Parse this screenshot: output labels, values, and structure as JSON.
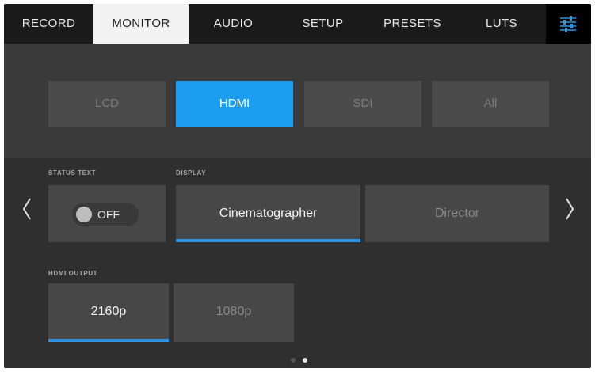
{
  "tabs": [
    {
      "label": "RECORD"
    },
    {
      "label": "MONITOR",
      "active": true
    },
    {
      "label": "AUDIO"
    },
    {
      "label": "SETUP"
    },
    {
      "label": "PRESETS"
    },
    {
      "label": "LUTS"
    }
  ],
  "settings_icon": "sliders-icon",
  "outputs": [
    "LCD",
    "HDMI",
    "SDI",
    "All"
  ],
  "selected_output": "HDMI",
  "status_text": {
    "label": "STATUS TEXT",
    "toggle_value": "OFF"
  },
  "display": {
    "label": "DISPLAY",
    "options": [
      "Cinematographer",
      "Director"
    ],
    "selected": "Cinematographer"
  },
  "hdmi_output": {
    "label": "HDMI OUTPUT",
    "options": [
      "2160p",
      "1080p"
    ],
    "selected": "2160p"
  },
  "nav": {
    "prev_icon": "chevron-left-icon",
    "next_icon": "chevron-right-icon"
  },
  "pagination": {
    "pages": 2,
    "current": 2
  },
  "colors": {
    "accent": "#1c9df0",
    "background": "#333333",
    "tab_bar": "#1a1a1a"
  }
}
